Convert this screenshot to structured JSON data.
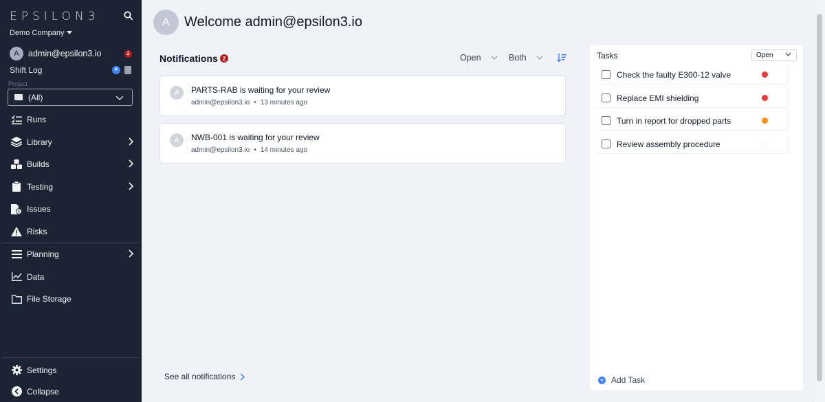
{
  "sidebar": {
    "logo": "EPSILON3",
    "company": "Demo Company",
    "user": {
      "avatar": "A",
      "email": "admin@epsilon3.io",
      "badge": "2"
    },
    "shift_log": "Shift Log",
    "project": {
      "label": "Project",
      "value": "(All)"
    },
    "items": [
      {
        "label": "Runs",
        "icon": "runs-list-icon",
        "arrow": false
      },
      {
        "label": "Library",
        "icon": "layers-icon",
        "arrow": true
      },
      {
        "label": "Builds",
        "icon": "cubes-icon",
        "arrow": true
      },
      {
        "label": "Testing",
        "icon": "clipboard-icon",
        "arrow": true
      },
      {
        "label": "Issues",
        "icon": "issue-file-icon",
        "arrow": false
      },
      {
        "label": "Risks",
        "icon": "warning-icon",
        "arrow": false
      },
      {
        "label": "Planning",
        "icon": "menu-icon",
        "arrow": true
      },
      {
        "label": "Data",
        "icon": "chart-line-icon",
        "arrow": false
      },
      {
        "label": "File Storage",
        "icon": "folder-icon",
        "arrow": false
      }
    ],
    "bottom": [
      {
        "label": "Settings",
        "icon": "gear-icon"
      },
      {
        "label": "Collapse",
        "icon": "collapse-icon"
      }
    ]
  },
  "main": {
    "avatar": "A",
    "welcome": "Welcome admin@epsilon3.io",
    "notifications": {
      "title": "Notifications",
      "badge": "2",
      "filter_status": "Open",
      "filter_scope": "Both",
      "items": [
        {
          "avatar": "A",
          "title": "PARTS-RAB is waiting for your review",
          "user": "admin@epsilon3.io",
          "time": "13 minutes ago"
        },
        {
          "avatar": "A",
          "title": "NWB-001 is waiting for your review",
          "user": "admin@epsilon3.io",
          "time": "14 minutes ago"
        }
      ],
      "see_all": "See all notifications"
    },
    "tasks": {
      "title": "Tasks",
      "filter": "Open",
      "items": [
        {
          "label": "Check the faulty E300-12 valve",
          "priority_color": "#e53e3e"
        },
        {
          "label": "Replace EMI shielding",
          "priority_color": "#e53e3e"
        },
        {
          "label": "Turn in report for dropped parts",
          "priority_color": "#f2911b"
        },
        {
          "label": "Review assembly procedure",
          "priority_color": "#ffffff"
        }
      ],
      "add_label": "Add Task"
    }
  }
}
